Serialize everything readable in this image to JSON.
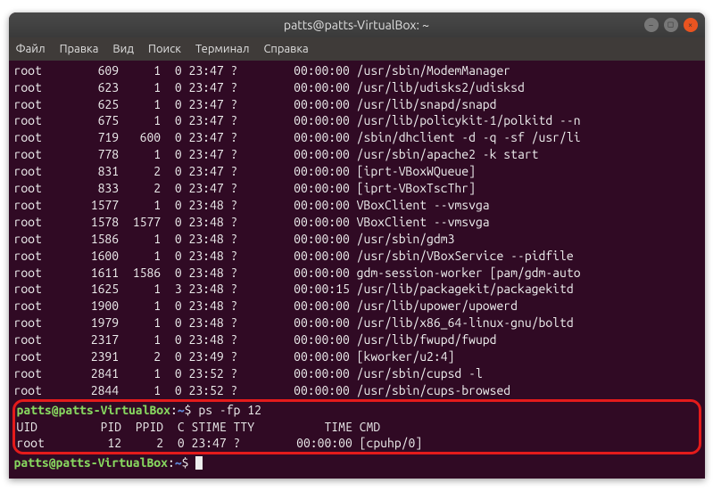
{
  "titlebar": {
    "title": "patts@patts-VirtualBox: ~"
  },
  "menu": {
    "file": "Файл",
    "edit": "Правка",
    "view": "Вид",
    "search": "Поиск",
    "terminal": "Терминал",
    "help": "Справка"
  },
  "prompt": {
    "userhost": "patts@patts-VirtualBox",
    "colon": ":",
    "path": "~",
    "dollar": "$"
  },
  "cmd1": "ps -fp 12",
  "header": {
    "uid": "UID",
    "pid": "PID",
    "ppid": "PPID",
    "c": "C",
    "stime": "STIME",
    "tty": "TTY",
    "time": "TIME",
    "cmd": "CMD"
  },
  "result": {
    "uid": "root",
    "pid": "12",
    "ppid": "2",
    "c": "0",
    "stime": "23:47",
    "tty": "?",
    "time": "00:00:00",
    "cmd": "[cpuhp/0]"
  },
  "rows": [
    {
      "uid": "root",
      "pid": "609",
      "ppid": "1",
      "c": "0",
      "stime": "23:47",
      "tty": "?",
      "time": "00:00:00",
      "cmd": "/usr/sbin/ModemManager"
    },
    {
      "uid": "root",
      "pid": "623",
      "ppid": "1",
      "c": "0",
      "stime": "23:47",
      "tty": "?",
      "time": "00:00:00",
      "cmd": "/usr/lib/udisks2/udisksd"
    },
    {
      "uid": "root",
      "pid": "625",
      "ppid": "1",
      "c": "0",
      "stime": "23:47",
      "tty": "?",
      "time": "00:00:00",
      "cmd": "/usr/lib/snapd/snapd"
    },
    {
      "uid": "root",
      "pid": "675",
      "ppid": "1",
      "c": "0",
      "stime": "23:47",
      "tty": "?",
      "time": "00:00:00",
      "cmd": "/usr/lib/policykit-1/polkitd --n"
    },
    {
      "uid": "root",
      "pid": "719",
      "ppid": "600",
      "c": "0",
      "stime": "23:47",
      "tty": "?",
      "time": "00:00:00",
      "cmd": "/sbin/dhclient -d -q -sf /usr/li"
    },
    {
      "uid": "root",
      "pid": "778",
      "ppid": "1",
      "c": "0",
      "stime": "23:47",
      "tty": "?",
      "time": "00:00:00",
      "cmd": "/usr/sbin/apache2 -k start"
    },
    {
      "uid": "root",
      "pid": "831",
      "ppid": "2",
      "c": "0",
      "stime": "23:47",
      "tty": "?",
      "time": "00:00:00",
      "cmd": "[iprt-VBoxWQueue]"
    },
    {
      "uid": "root",
      "pid": "833",
      "ppid": "2",
      "c": "0",
      "stime": "23:47",
      "tty": "?",
      "time": "00:00:00",
      "cmd": "[iprt-VBoxTscThr]"
    },
    {
      "uid": "root",
      "pid": "1577",
      "ppid": "1",
      "c": "0",
      "stime": "23:48",
      "tty": "?",
      "time": "00:00:00",
      "cmd": "VBoxClient --vmsvga"
    },
    {
      "uid": "root",
      "pid": "1578",
      "ppid": "1577",
      "c": "0",
      "stime": "23:48",
      "tty": "?",
      "time": "00:00:00",
      "cmd": "VBoxClient --vmsvga"
    },
    {
      "uid": "root",
      "pid": "1586",
      "ppid": "1",
      "c": "0",
      "stime": "23:48",
      "tty": "?",
      "time": "00:00:00",
      "cmd": "/usr/sbin/gdm3"
    },
    {
      "uid": "root",
      "pid": "1600",
      "ppid": "1",
      "c": "0",
      "stime": "23:48",
      "tty": "?",
      "time": "00:00:00",
      "cmd": "/usr/sbin/VBoxService --pidfile"
    },
    {
      "uid": "root",
      "pid": "1611",
      "ppid": "1586",
      "c": "0",
      "stime": "23:48",
      "tty": "?",
      "time": "00:00:00",
      "cmd": "gdm-session-worker [pam/gdm-auto"
    },
    {
      "uid": "root",
      "pid": "1625",
      "ppid": "1",
      "c": "3",
      "stime": "23:48",
      "tty": "?",
      "time": "00:00:15",
      "cmd": "/usr/lib/packagekit/packagekitd"
    },
    {
      "uid": "root",
      "pid": "1900",
      "ppid": "1",
      "c": "0",
      "stime": "23:48",
      "tty": "?",
      "time": "00:00:00",
      "cmd": "/usr/lib/upower/upowerd"
    },
    {
      "uid": "root",
      "pid": "1979",
      "ppid": "1",
      "c": "0",
      "stime": "23:48",
      "tty": "?",
      "time": "00:00:00",
      "cmd": "/usr/lib/x86_64-linux-gnu/boltd"
    },
    {
      "uid": "root",
      "pid": "2317",
      "ppid": "1",
      "c": "0",
      "stime": "23:48",
      "tty": "?",
      "time": "00:00:00",
      "cmd": "/usr/lib/fwupd/fwupd"
    },
    {
      "uid": "root",
      "pid": "2391",
      "ppid": "2",
      "c": "0",
      "stime": "23:49",
      "tty": "?",
      "time": "00:00:00",
      "cmd": "[kworker/u2:4]"
    },
    {
      "uid": "root",
      "pid": "2841",
      "ppid": "1",
      "c": "0",
      "stime": "23:52",
      "tty": "?",
      "time": "00:00:00",
      "cmd": "/usr/sbin/cupsd -l"
    },
    {
      "uid": "root",
      "pid": "2844",
      "ppid": "1",
      "c": "0",
      "stime": "23:52",
      "tty": "?",
      "time": "00:00:00",
      "cmd": "/usr/sbin/cups-browsed"
    }
  ]
}
